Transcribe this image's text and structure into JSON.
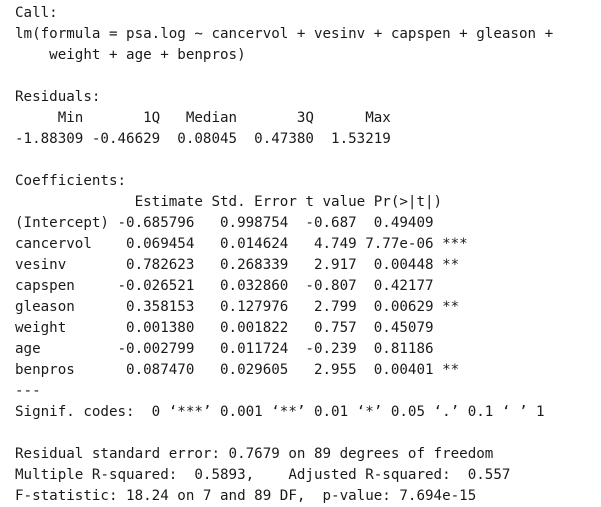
{
  "call": {
    "heading": "Call:",
    "formula_line1": "lm(formula = psa.log ~ cancervol + vesinv + capspen + gleason +",
    "formula_line2": "    weight + age + benpros)"
  },
  "residuals": {
    "heading": "Residuals:",
    "header": "     Min       1Q   Median       3Q      Max ",
    "values": "-1.88309 -0.46629  0.08045  0.47380  1.53219 "
  },
  "coefficients": {
    "heading": "Coefficients:",
    "header": "              Estimate Std. Error t value Pr(>|t|)    ",
    "rows": [
      "(Intercept) -0.685796   0.998754  -0.687  0.49409    ",
      "cancervol    0.069454   0.014624   4.749 7.77e-06 ***",
      "vesinv       0.782623   0.268339   2.917  0.00448 ** ",
      "capspen     -0.026521   0.032860  -0.807  0.42177    ",
      "gleason      0.358153   0.127976   2.799  0.00629 ** ",
      "weight       0.001380   0.001822   0.757  0.45079    ",
      "age         -0.002799   0.011724  -0.239  0.81186    ",
      "benpros      0.087470   0.029605   2.955  0.00401 ** "
    ],
    "separator": "---",
    "signif_codes": "Signif. codes:  0 ‘***’ 0.001 ‘**’ 0.01 ‘*’ 0.05 ‘.’ 0.1 ‘ ’ 1"
  },
  "summary": {
    "residual_se": "Residual standard error: 0.7679 on 89 degrees of freedom",
    "r_squared": "Multiple R-squared:  0.5893,\tAdjusted R-squared:  0.557 ",
    "f_statistic": "F-statistic: 18.24 on 7 and 89 DF,  p-value: 7.694e-15"
  }
}
